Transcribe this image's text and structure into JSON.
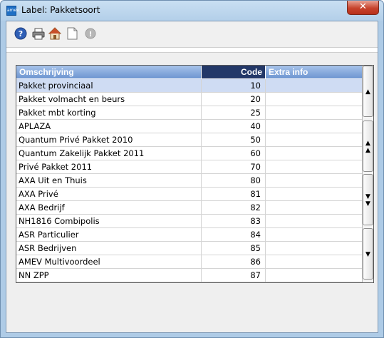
{
  "window": {
    "title": "Label: Pakketsoort",
    "app_icon_text": "amev",
    "close_glyph": "✕"
  },
  "toolbar": {
    "buttons": [
      {
        "icon": "help-icon",
        "enabled": true
      },
      {
        "icon": "print-icon",
        "enabled": true
      },
      {
        "icon": "home-icon",
        "enabled": true
      },
      {
        "icon": "new-document-icon",
        "enabled": true
      },
      {
        "icon": "info-icon",
        "enabled": false
      }
    ]
  },
  "grid": {
    "columns": {
      "description": "Omschrijving",
      "code": "Code",
      "extra": "Extra info"
    },
    "rows": [
      {
        "description": "Pakket provinciaal",
        "code": "10",
        "extra": "",
        "selected": true
      },
      {
        "description": "Pakket volmacht en beurs",
        "code": "20",
        "extra": ""
      },
      {
        "description": "Pakket mbt korting",
        "code": "25",
        "extra": ""
      },
      {
        "description": "APLAZA",
        "code": "40",
        "extra": ""
      },
      {
        "description": "Quantum Privé Pakket 2010",
        "code": "50",
        "extra": ""
      },
      {
        "description": "Quantum Zakelijk Pakket 2011",
        "code": "60",
        "extra": ""
      },
      {
        "description": "Privé Pakket 2011",
        "code": "70",
        "extra": ""
      },
      {
        "description": "AXA Uit en Thuis",
        "code": "80",
        "extra": ""
      },
      {
        "description": "AXA Privé",
        "code": "81",
        "extra": ""
      },
      {
        "description": "AXA Bedrijf",
        "code": "82",
        "extra": ""
      },
      {
        "description": "NH1816 Combipolis",
        "code": "83",
        "extra": ""
      },
      {
        "description": "ASR Particulier",
        "code": "84",
        "extra": ""
      },
      {
        "description": "ASR Bedrijven",
        "code": "85",
        "extra": ""
      },
      {
        "description": "AMEV Multivoordeel",
        "code": "86",
        "extra": ""
      },
      {
        "description": "NN ZPP",
        "code": "87",
        "extra": ""
      }
    ]
  },
  "scroll_buttons": [
    {
      "name": "scroll-first-button",
      "glyph": "▲"
    },
    {
      "name": "scroll-page-up-button",
      "glyph": "▲▲"
    },
    {
      "name": "scroll-page-down-button",
      "glyph": "▼▼"
    },
    {
      "name": "scroll-last-button",
      "glyph": "▼"
    }
  ]
}
